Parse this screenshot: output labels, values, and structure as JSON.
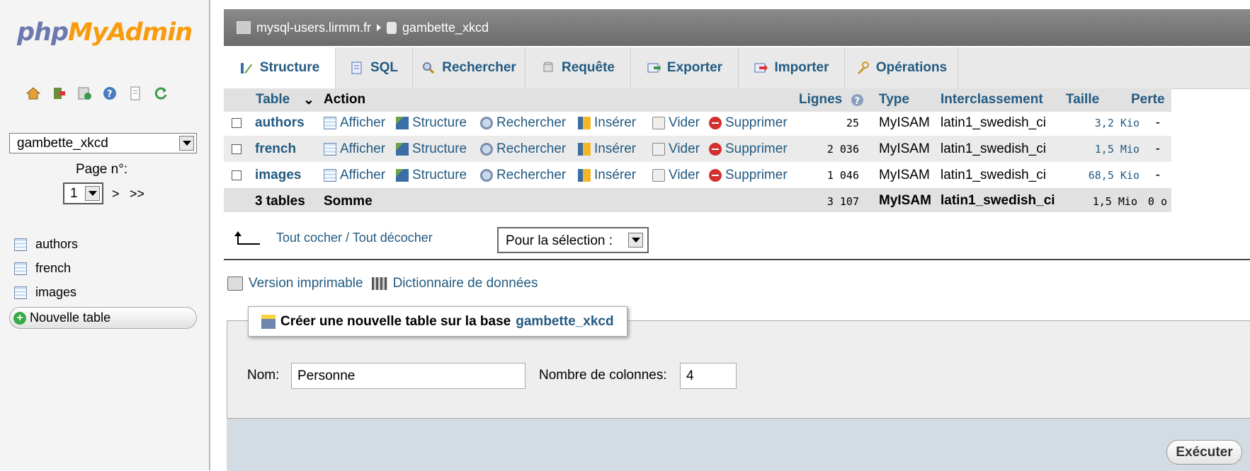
{
  "logo": {
    "part1": "php",
    "part2": "MyAdmin"
  },
  "left": {
    "quick_icons": [
      "home-icon",
      "exit-icon",
      "query-window-icon",
      "help-icon",
      "docs-icon",
      "reload-icon"
    ],
    "db_select_value": "gambette_xkcd",
    "page_label": "Page n°:",
    "page_value": "1",
    "page_next": ">",
    "page_last": ">>",
    "tables": [
      "authors",
      "french",
      "images"
    ],
    "new_table": "Nouvelle table"
  },
  "breadcrumb": {
    "server": "mysql-users.lirmm.fr",
    "database": "gambette_xkcd"
  },
  "tabs": [
    {
      "label": "Structure",
      "icon": "structure-icon"
    },
    {
      "label": "SQL",
      "icon": "sql-icon"
    },
    {
      "label": "Rechercher",
      "icon": "search-icon"
    },
    {
      "label": "Requête",
      "icon": "query-icon"
    },
    {
      "label": "Exporter",
      "icon": "export-icon"
    },
    {
      "label": "Importer",
      "icon": "import-icon"
    },
    {
      "label": "Opérations",
      "icon": "wrench-icon"
    }
  ],
  "table_header": {
    "table": "Table",
    "action": "Action",
    "rows": "Lignes",
    "type": "Type",
    "collation": "Interclassement",
    "size": "Taille",
    "overhead": "Perte"
  },
  "actions": {
    "browse": "Afficher",
    "structure": "Structure",
    "search": "Rechercher",
    "insert": "Insérer",
    "empty": "Vider",
    "drop": "Supprimer"
  },
  "rows": [
    {
      "name": "authors",
      "rows": "25",
      "type": "MyISAM",
      "collation": "latin1_swedish_ci",
      "size": "3,2 Kio",
      "overhead": "-"
    },
    {
      "name": "french",
      "rows": "2 036",
      "type": "MyISAM",
      "collation": "latin1_swedish_ci",
      "size": "1,5 Mio",
      "overhead": "-"
    },
    {
      "name": "images",
      "rows": "1 046",
      "type": "MyISAM",
      "collation": "latin1_swedish_ci",
      "size": "68,5 Kio",
      "overhead": "-"
    }
  ],
  "summary": {
    "tables": "3 tables",
    "label": "Somme",
    "rows": "3 107",
    "type": "MyISAM",
    "collation": "latin1_swedish_ci",
    "size": "1,5 Mio",
    "overhead": "0 o"
  },
  "select_all": "Tout cocher / Tout décocher",
  "with_selected": "Pour la sélection :",
  "print_view": "Version imprimable",
  "data_dictionary": "Dictionnaire de données",
  "create": {
    "legend": "Créer une nouvelle table sur la base",
    "db": "gambette_xkcd",
    "name_label": "Nom:",
    "name_value": "Personne",
    "cols_label": "Nombre de colonnes:",
    "cols_value": "4",
    "execute": "Exécuter"
  },
  "colors": {
    "link": "#235a81",
    "logo_php": "#6c78af",
    "logo_myadmin": "#f89c0e"
  }
}
